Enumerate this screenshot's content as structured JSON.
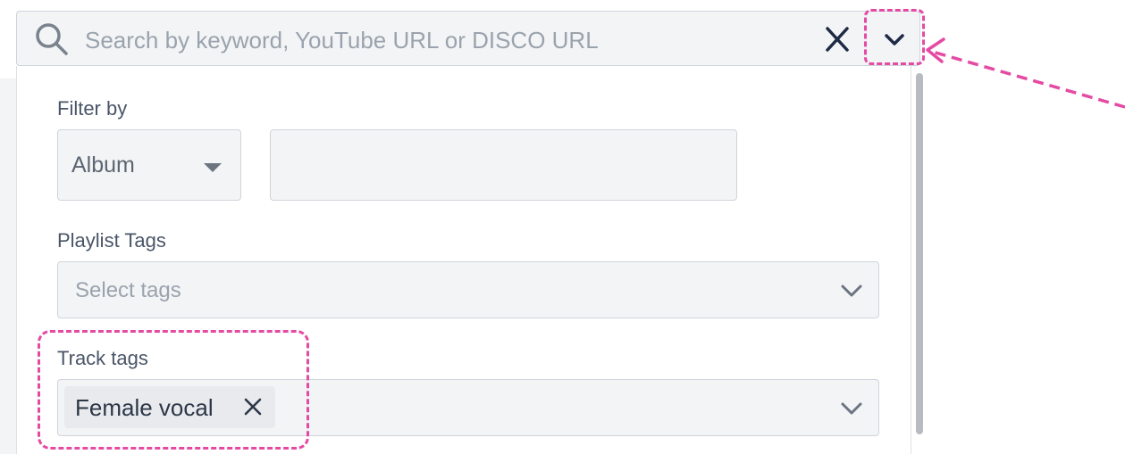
{
  "search": {
    "placeholder": "Search by keyword, YouTube URL or DISCO URL",
    "value": ""
  },
  "icons": {
    "search": "search-icon",
    "clear": "close-icon",
    "toggle": "chevron-down-icon",
    "tag_remove": "close-icon"
  },
  "filters": {
    "filter_by_label": "Filter by",
    "filter_select_value": "Album",
    "filter_text_value": "",
    "playlist_tags_label": "Playlist Tags",
    "playlist_tags_placeholder": "Select tags",
    "track_tags_label": "Track tags",
    "track_tags_selected": [
      "Female vocal"
    ]
  },
  "colors": {
    "highlight": "#e54aa3",
    "field_background": "#f3f4f6",
    "chip_background": "#e8eaed",
    "text": "#4a5568",
    "placeholder": "#9aa3ad"
  }
}
